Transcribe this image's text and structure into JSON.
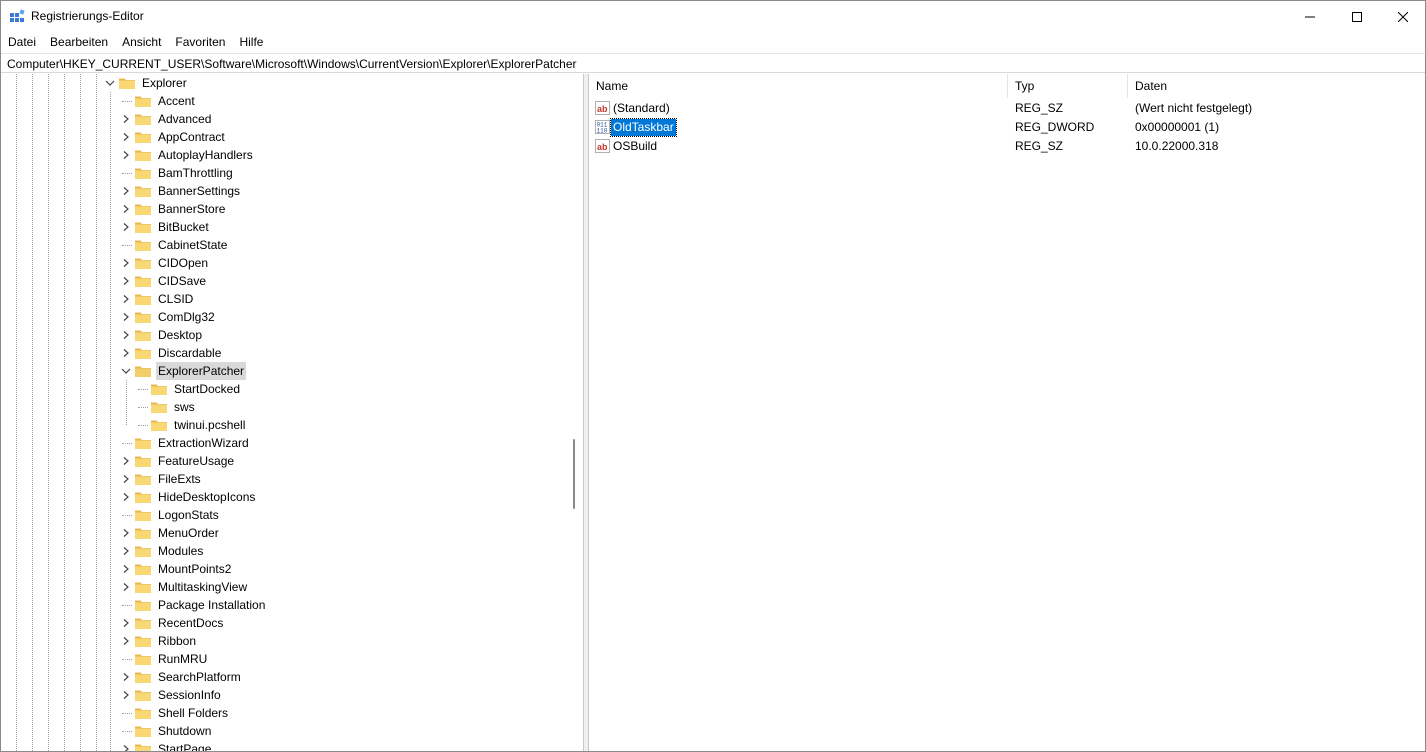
{
  "window": {
    "title": "Registrierungs-Editor"
  },
  "menu": [
    {
      "label": "Datei"
    },
    {
      "label": "Bearbeiten"
    },
    {
      "label": "Ansicht"
    },
    {
      "label": "Favoriten"
    },
    {
      "label": "Hilfe"
    }
  ],
  "address": {
    "path": "Computer\\HKEY_CURRENT_USER\\Software\\Microsoft\\Windows\\CurrentVersion\\Explorer\\ExplorerPatcher"
  },
  "tree": {
    "items": [
      {
        "label": "Explorer",
        "level": 0,
        "expander": "expanded",
        "selected": false
      },
      {
        "label": "Accent",
        "level": 1,
        "expander": "none",
        "selected": false
      },
      {
        "label": "Advanced",
        "level": 1,
        "expander": "collapsed",
        "selected": false
      },
      {
        "label": "AppContract",
        "level": 1,
        "expander": "collapsed",
        "selected": false
      },
      {
        "label": "AutoplayHandlers",
        "level": 1,
        "expander": "collapsed",
        "selected": false
      },
      {
        "label": "BamThrottling",
        "level": 1,
        "expander": "none",
        "selected": false
      },
      {
        "label": "BannerSettings",
        "level": 1,
        "expander": "collapsed",
        "selected": false
      },
      {
        "label": "BannerStore",
        "level": 1,
        "expander": "collapsed",
        "selected": false
      },
      {
        "label": "BitBucket",
        "level": 1,
        "expander": "collapsed",
        "selected": false
      },
      {
        "label": "CabinetState",
        "level": 1,
        "expander": "none",
        "selected": false
      },
      {
        "label": "CIDOpen",
        "level": 1,
        "expander": "collapsed",
        "selected": false
      },
      {
        "label": "CIDSave",
        "level": 1,
        "expander": "collapsed",
        "selected": false
      },
      {
        "label": "CLSID",
        "level": 1,
        "expander": "collapsed",
        "selected": false
      },
      {
        "label": "ComDlg32",
        "level": 1,
        "expander": "collapsed",
        "selected": false
      },
      {
        "label": "Desktop",
        "level": 1,
        "expander": "collapsed",
        "selected": false
      },
      {
        "label": "Discardable",
        "level": 1,
        "expander": "collapsed",
        "selected": false
      },
      {
        "label": "ExplorerPatcher",
        "level": 1,
        "expander": "expanded",
        "selected": true
      },
      {
        "label": "StartDocked",
        "level": 2,
        "expander": "none",
        "selected": false
      },
      {
        "label": "sws",
        "level": 2,
        "expander": "none",
        "selected": false
      },
      {
        "label": "twinui.pcshell",
        "level": 2,
        "expander": "none",
        "selected": false
      },
      {
        "label": "ExtractionWizard",
        "level": 1,
        "expander": "none",
        "selected": false
      },
      {
        "label": "FeatureUsage",
        "level": 1,
        "expander": "collapsed",
        "selected": false
      },
      {
        "label": "FileExts",
        "level": 1,
        "expander": "collapsed",
        "selected": false
      },
      {
        "label": "HideDesktopIcons",
        "level": 1,
        "expander": "collapsed",
        "selected": false
      },
      {
        "label": "LogonStats",
        "level": 1,
        "expander": "none",
        "selected": false
      },
      {
        "label": "MenuOrder",
        "level": 1,
        "expander": "collapsed",
        "selected": false
      },
      {
        "label": "Modules",
        "level": 1,
        "expander": "collapsed",
        "selected": false
      },
      {
        "label": "MountPoints2",
        "level": 1,
        "expander": "collapsed",
        "selected": false
      },
      {
        "label": "MultitaskingView",
        "level": 1,
        "expander": "collapsed",
        "selected": false
      },
      {
        "label": "Package Installation",
        "level": 1,
        "expander": "none",
        "selected": false
      },
      {
        "label": "RecentDocs",
        "level": 1,
        "expander": "collapsed",
        "selected": false
      },
      {
        "label": "Ribbon",
        "level": 1,
        "expander": "collapsed",
        "selected": false
      },
      {
        "label": "RunMRU",
        "level": 1,
        "expander": "none",
        "selected": false
      },
      {
        "label": "SearchPlatform",
        "level": 1,
        "expander": "collapsed",
        "selected": false
      },
      {
        "label": "SessionInfo",
        "level": 1,
        "expander": "collapsed",
        "selected": false
      },
      {
        "label": "Shell Folders",
        "level": 1,
        "expander": "none",
        "selected": false
      },
      {
        "label": "Shutdown",
        "level": 1,
        "expander": "none",
        "selected": false
      },
      {
        "label": "StartPage",
        "level": 1,
        "expander": "collapsed",
        "selected": false
      }
    ]
  },
  "list": {
    "columns": {
      "name": "Name",
      "type": "Typ",
      "data": "Daten"
    },
    "rows": [
      {
        "icon": "string-value-icon",
        "name": "(Standard)",
        "type": "REG_SZ",
        "data": "(Wert nicht festgelegt)",
        "selected": false
      },
      {
        "icon": "dword-value-icon",
        "name": "OldTaskbar",
        "type": "REG_DWORD",
        "data": "0x00000001 (1)",
        "selected": true
      },
      {
        "icon": "string-value-icon",
        "name": "OSBuild",
        "type": "REG_SZ",
        "data": "10.0.22000.318",
        "selected": false
      }
    ]
  },
  "colors": {
    "selection": "#0078d7",
    "folder": "#f8d775",
    "tree_selected": "#d9d9d9"
  }
}
